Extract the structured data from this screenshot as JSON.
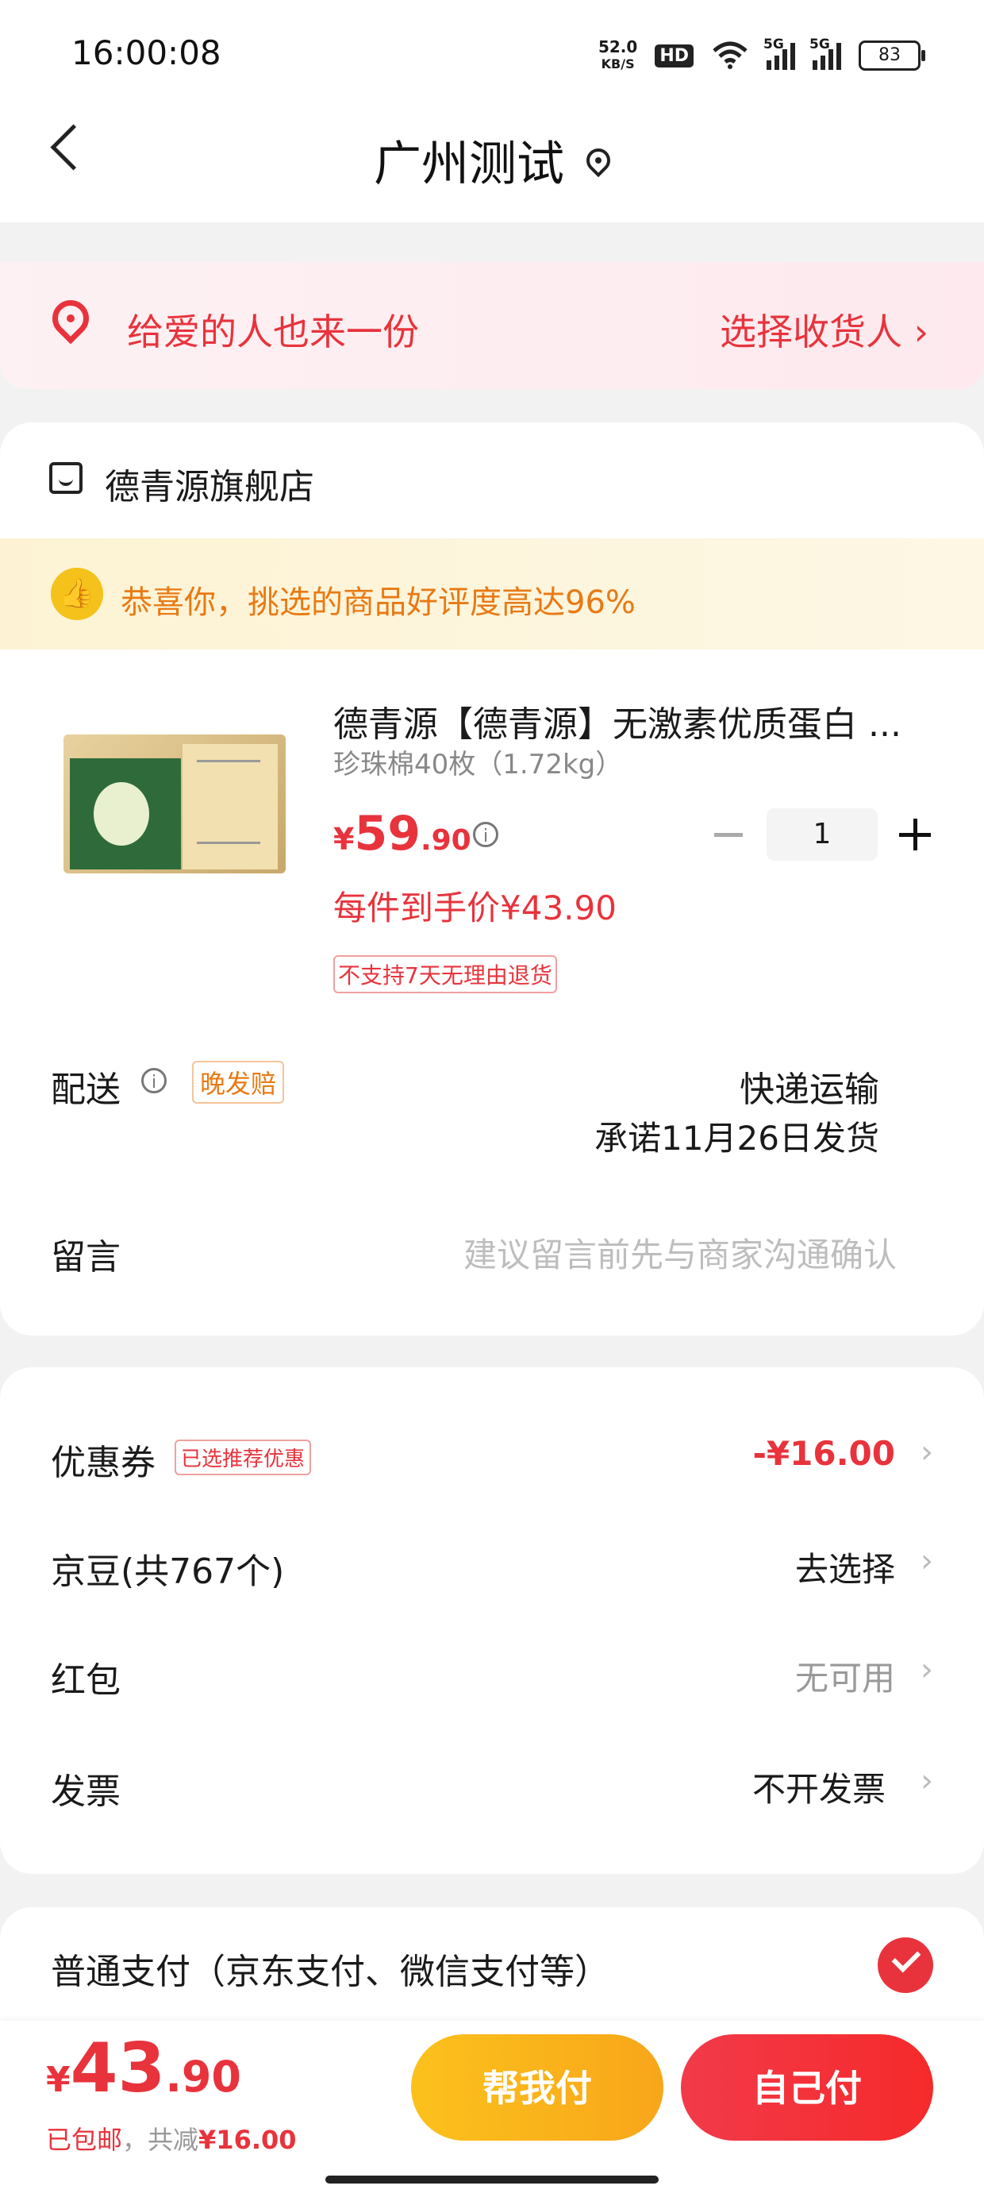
{
  "status_bar": {
    "time": "16:00:08",
    "net_speed_value": "52.0",
    "net_speed_unit": "KB/S",
    "hd": "HD",
    "signal_1": "5G",
    "signal_2": "5G",
    "battery": "83"
  },
  "header": {
    "title": "广州测试",
    "back_icon": "chevron-left-icon",
    "location_icon": "location-pin-icon"
  },
  "gift_banner": {
    "text": "给爱的人也来一份",
    "action": "选择收货人 ›",
    "icon": "map-pin-icon"
  },
  "store": {
    "name": "德青源旗舰店",
    "icon": "store-icon",
    "rating_banner": "恭喜你，挑选的商品好评度高达96%"
  },
  "product": {
    "title": "德青源【德青源】无激素优质蛋白 ...",
    "spec": "珍珠棉40枚（1.72kg）",
    "price_currency": "¥",
    "price_int": "59",
    "price_dec": ".90",
    "quantity": "1",
    "per_item_price": "每件到手价¥43.90",
    "return_policy": "不支持7天无理由退货"
  },
  "delivery": {
    "label": "配送",
    "late_badge": "晚发赔",
    "method": "快递运输",
    "promise": "承诺11月26日发货"
  },
  "message": {
    "label": "留言",
    "placeholder": "建议留言前先与商家沟通确认"
  },
  "discounts": {
    "coupon_label": "优惠券",
    "coupon_badge": "已选推荐优惠",
    "coupon_value": "-¥16.00",
    "beans_label": "京豆(共767个)",
    "beans_value": "去选择",
    "redpacket_label": "红包",
    "redpacket_value": "无可用",
    "invoice_label": "发票",
    "invoice_value": "不开发票",
    "chevron": "›"
  },
  "payment": {
    "label": "普通支付（京东支付、微信支付等）"
  },
  "bottom_bar": {
    "currency": "¥",
    "total_int": "43",
    "total_dec": ".90",
    "shipping": "已包邮",
    "saved_prefix": "，共减",
    "saved_amount": "¥16.00",
    "help_pay": "帮我付",
    "self_pay": "自己付"
  },
  "colors": {
    "accent_red": "#e8333c",
    "accent_orange": "#e87a14",
    "help_btn": "#fcc11c"
  }
}
